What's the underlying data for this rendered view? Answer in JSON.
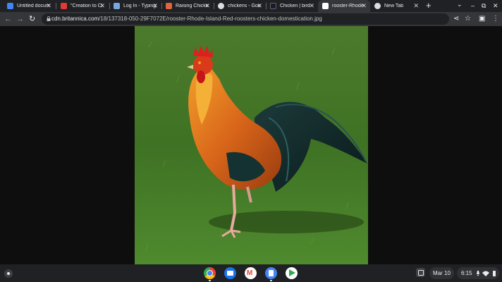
{
  "tabs": [
    {
      "title": "Untitled docum",
      "icon": "docs-icon",
      "color": "#4285f4",
      "active": false
    },
    {
      "title": "\"Creation to Cl",
      "icon": "heart-icon",
      "color": "#e53935",
      "active": false
    },
    {
      "title": "Log In - Typing",
      "icon": "typing-icon",
      "color": "#7aa7e0",
      "active": false
    },
    {
      "title": "Raising Chicke",
      "icon": "chicken-site-icon",
      "color": "#e0643c",
      "active": false
    },
    {
      "title": "chickens - Goo",
      "icon": "google-icon",
      "color": "#dadce0",
      "active": false
    },
    {
      "title": "Chicken | bird",
      "icon": "britannica-icon",
      "color": "#1a1a2e",
      "active": false
    },
    {
      "title": "rooster-Rhode-",
      "icon": "page-icon",
      "color": "#ffffff",
      "active": true
    },
    {
      "title": "New Tab",
      "icon": "chrome-icon",
      "color": "#dadce0",
      "active": false
    }
  ],
  "window_controls": {
    "tab_search": "⌄",
    "minimize": "–",
    "restore": "⧉",
    "close": "✕"
  },
  "new_tab": "+",
  "toolbar": {
    "back": "←",
    "forward": "→",
    "reload": "↻",
    "url_host": "cdn.britannica.com",
    "url_path": "/18/137318-050-29F7072E/rooster-Rhode-Island-Red-roosters-chicken-domestication.jpg",
    "share": "⋖",
    "bookmark": "☆",
    "side_panel": "▣",
    "menu": "⋮"
  },
  "shelf": {
    "apps": [
      {
        "name": "chrome-app-icon",
        "color": "#4285f4"
      },
      {
        "name": "files-app-icon",
        "color": "#1a73e8"
      },
      {
        "name": "gmail-app-icon",
        "color": "#ea4335"
      },
      {
        "name": "docs-app-icon",
        "color": "#4285f4"
      },
      {
        "name": "play-store-app-icon",
        "color": "#34a853"
      }
    ],
    "date": "Mar 10",
    "time": "6:15"
  }
}
